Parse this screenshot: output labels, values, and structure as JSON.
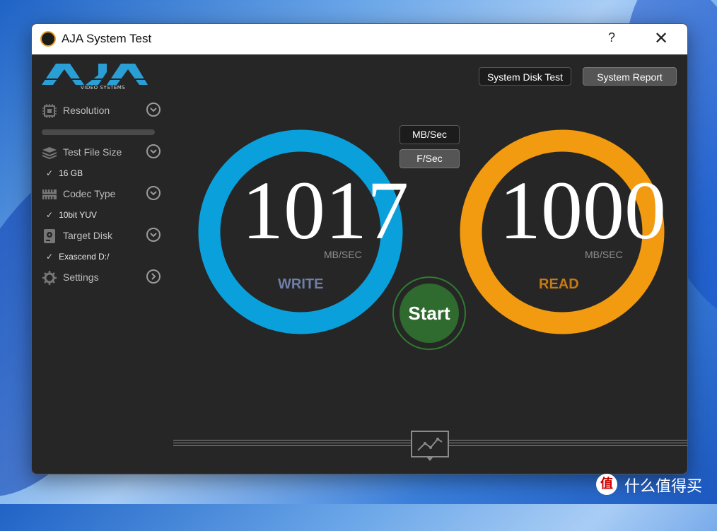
{
  "window": {
    "title": "AJA System Test",
    "help": "?",
    "close": "✕"
  },
  "logo": {
    "name": "AJA",
    "subtitle": "VIDEO SYSTEMS"
  },
  "top_buttons": {
    "disk_test": "System Disk Test",
    "report": "System Report"
  },
  "sidebar": {
    "resolution": {
      "label": "Resolution",
      "icon": "chip-icon"
    },
    "file_size": {
      "label": "Test File Size",
      "value": "16 GB",
      "icon": "layers-icon"
    },
    "codec": {
      "label": "Codec Type",
      "value": "10bit YUV",
      "icon": "film-icon"
    },
    "disk": {
      "label": "Target Disk",
      "value": "Exascend D:/",
      "icon": "disk-icon"
    },
    "settings": {
      "label": "Settings",
      "icon": "gear-icon"
    }
  },
  "units": {
    "mb": "MB/Sec",
    "fps": "F/Sec",
    "selected": "F/Sec"
  },
  "write": {
    "value": "1017",
    "unit": "MB/SEC",
    "label": "WRITE",
    "color": "#0aa0dc",
    "label_color": "#6f7fa8"
  },
  "read": {
    "value": "1000",
    "unit": "MB/SEC",
    "label": "READ",
    "color": "#f29a10",
    "label_color": "#c57a16"
  },
  "start": {
    "label": "Start"
  },
  "watermark": {
    "badge": "值",
    "text": "什么值得买"
  }
}
